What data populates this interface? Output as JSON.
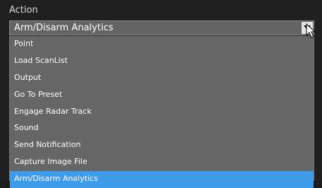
{
  "action": {
    "label": "Action",
    "selected_value": "Arm/Disarm Analytics",
    "options": [
      "Point",
      "Load ScanList",
      "Output",
      "Go To Preset",
      "Engage Radar Track",
      "Sound",
      "Send Notification",
      "Capture Image File",
      "Arm/Disarm Analytics"
    ],
    "highlighted_index": 8
  },
  "colors": {
    "background": "#202020",
    "dropdown": "#666666",
    "highlight": "#3d9be9"
  },
  "icons": {
    "dropdown_arrow": "chevron-down-icon",
    "cursor": "mouse-pointer-icon"
  }
}
